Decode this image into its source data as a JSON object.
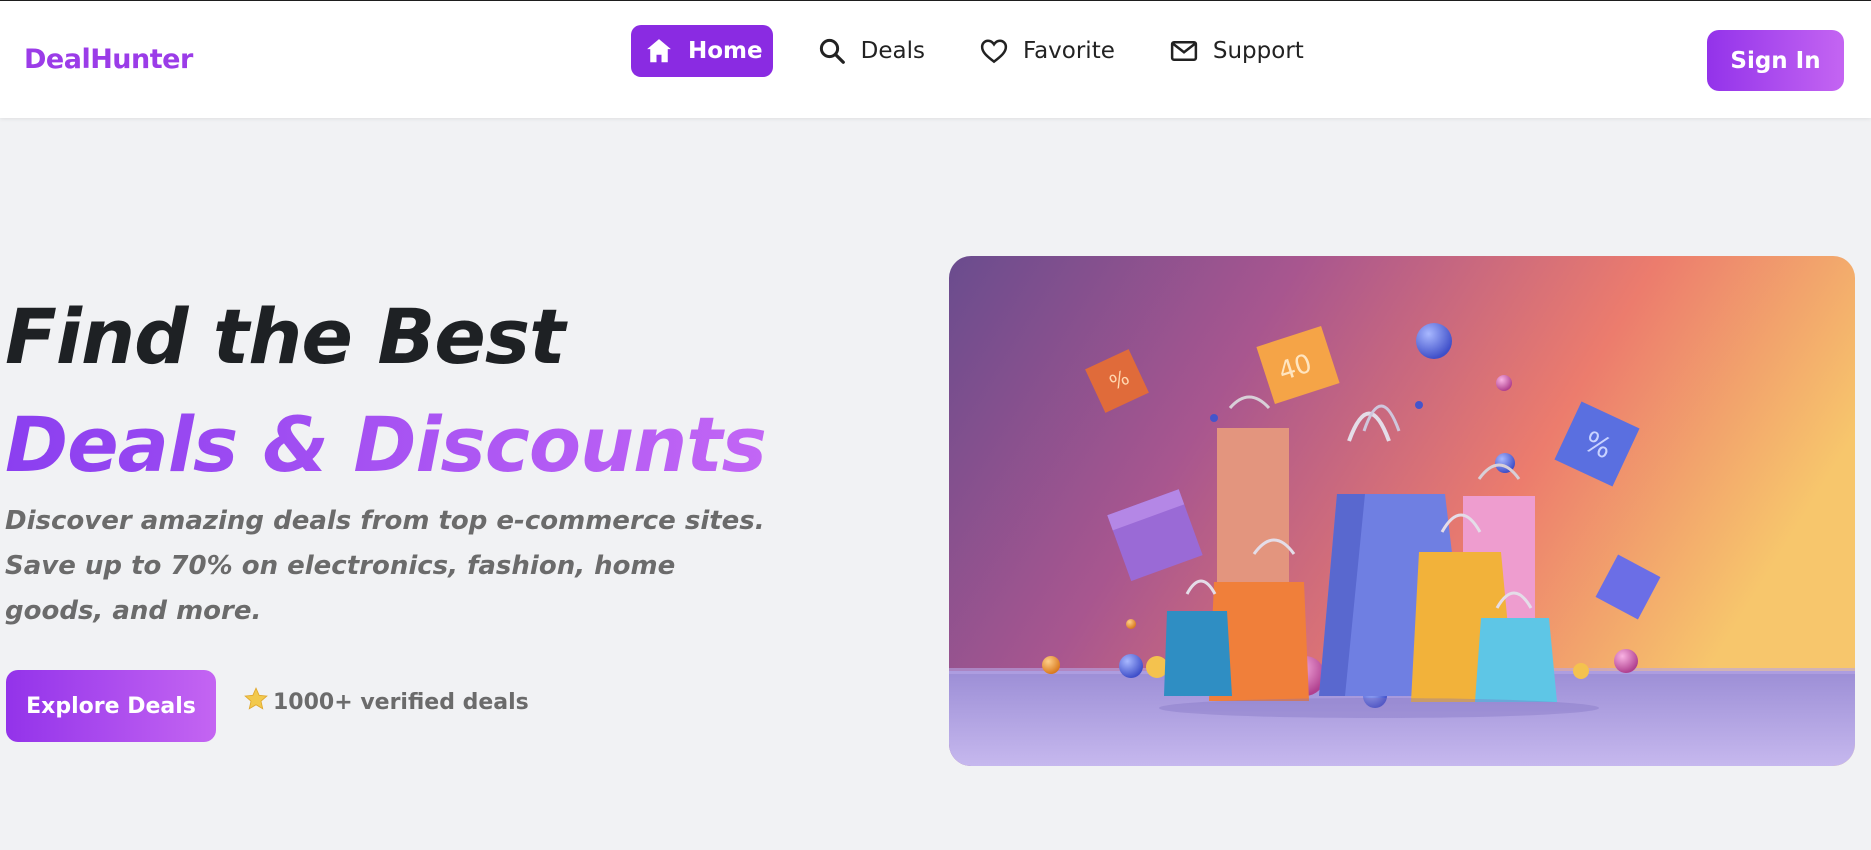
{
  "brand": {
    "name": "DealHunter",
    "color": "#9b3ce8"
  },
  "nav": {
    "items": [
      {
        "label": "Home",
        "icon": "home-icon",
        "active": true
      },
      {
        "label": "Deals",
        "icon": "search-icon",
        "active": false
      },
      {
        "label": "Favorite",
        "icon": "heart-icon",
        "active": false
      },
      {
        "label": "Support",
        "icon": "mail-icon",
        "active": false
      }
    ]
  },
  "header": {
    "signin_label": "Sign In"
  },
  "hero": {
    "title_line1": "Find the Best",
    "title_line2": "Deals & Discounts",
    "description": "Discover amazing deals from top e-commerce sites. Save up to 70% on electronics, fashion, home goods, and more.",
    "cta_label": "Explore Deals",
    "verified_icon": "star-icon",
    "verified_text": "1000+ verified deals",
    "image_icon": "shopping-bags-illustration"
  },
  "colors": {
    "accent": "#9333ea",
    "accent_light": "#c465f2",
    "text_dark": "#1e2124",
    "text_muted": "#6b6b6b",
    "background": "#f1f2f4"
  }
}
